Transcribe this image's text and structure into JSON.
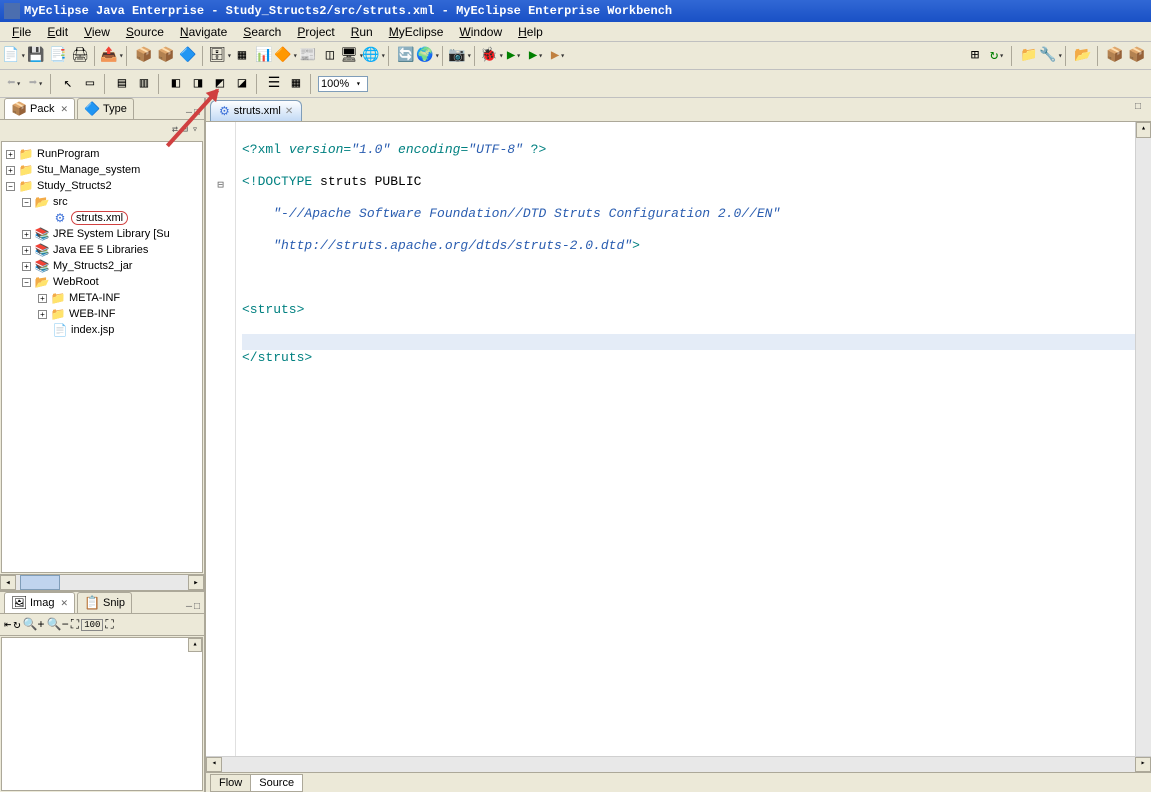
{
  "title": "MyEclipse Java Enterprise - Study_Structs2/src/struts.xml - MyEclipse Enterprise Workbench",
  "menu": [
    "File",
    "Edit",
    "View",
    "Source",
    "Navigate",
    "Search",
    "Project",
    "Run",
    "MyEclipse",
    "Window",
    "Help"
  ],
  "zoom": "100%",
  "sidebar": {
    "tabs": [
      {
        "label": "Pack",
        "icon": "📦",
        "active": true
      },
      {
        "label": "Type",
        "icon": "🔷",
        "active": false
      }
    ],
    "tree": [
      {
        "indent": 0,
        "expand": "+",
        "icon": "📁",
        "label": "RunProgram",
        "iconClass": "java-icon"
      },
      {
        "indent": 0,
        "expand": "+",
        "icon": "📁",
        "label": "Stu_Manage_system",
        "iconClass": "java-icon"
      },
      {
        "indent": 0,
        "expand": "−",
        "icon": "📁",
        "label": "Study_Structs2",
        "iconClass": "java-icon"
      },
      {
        "indent": 1,
        "expand": "−",
        "icon": "📂",
        "label": "src",
        "iconClass": "folder-icon"
      },
      {
        "indent": 2,
        "expand": "",
        "icon": "⚙",
        "label": "struts.xml",
        "iconClass": "gear-icon",
        "selected": true
      },
      {
        "indent": 1,
        "expand": "+",
        "icon": "📚",
        "label": "JRE System Library [Su",
        "iconClass": "jar-icon"
      },
      {
        "indent": 1,
        "expand": "+",
        "icon": "📚",
        "label": "Java EE 5 Libraries",
        "iconClass": "jar-icon"
      },
      {
        "indent": 1,
        "expand": "+",
        "icon": "📚",
        "label": "My_Structs2_jar",
        "iconClass": "jar-icon"
      },
      {
        "indent": 1,
        "expand": "−",
        "icon": "📂",
        "label": "WebRoot",
        "iconClass": "folder-icon"
      },
      {
        "indent": 2,
        "expand": "+",
        "icon": "📁",
        "label": "META-INF",
        "iconClass": "folder-icon"
      },
      {
        "indent": 2,
        "expand": "+",
        "icon": "📁",
        "label": "WEB-INF",
        "iconClass": "folder-icon"
      },
      {
        "indent": 2,
        "expand": "",
        "icon": "📄",
        "label": "index.jsp",
        "iconClass": "file-icon"
      }
    ]
  },
  "bottom_tabs": [
    {
      "label": "Imag",
      "icon": "🖼",
      "active": true
    },
    {
      "label": "Snip",
      "icon": "📋",
      "active": false
    }
  ],
  "editor": {
    "tab": {
      "label": "struts.xml",
      "icon": "⚙"
    },
    "bottom_tabs": [
      "Flow",
      "Source"
    ],
    "lines": {
      "l1_pre": "<?xml ",
      "l1_attr1": "version=",
      "l1_val1": "\"1.0\"",
      "l1_attr2": " encoding=",
      "l1_val2": "\"UTF-8\"",
      "l1_post": " ?>",
      "l2_pre": "<!DOCTYPE ",
      "l2_name": "struts ",
      "l2_kw": "PUBLIC",
      "l3": "    \"-//Apache Software Foundation//DTD Struts Configuration 2.0//EN\"",
      "l4_body": "    \"http://struts.apache.org/dtds/struts-2.0.dtd\"",
      "l4_close": ">",
      "l6": "<struts>",
      "l8": "</struts>"
    }
  }
}
